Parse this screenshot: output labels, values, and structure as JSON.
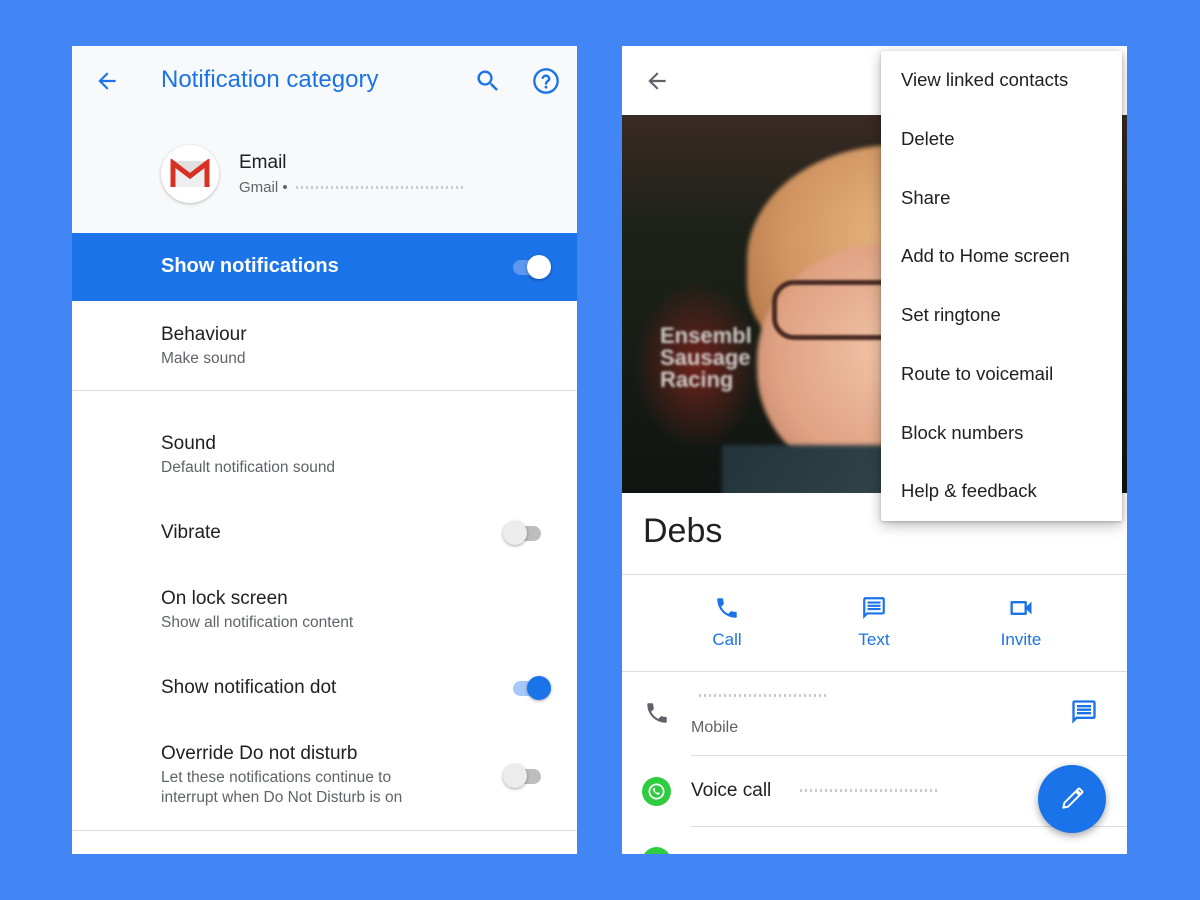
{
  "colors": {
    "background": "#4285f4",
    "accent": "#1a73e8",
    "header_bg": "#f8f9fa",
    "text_primary": "#202124",
    "text_secondary": "#5f6368",
    "whatsapp": "#2ecc40",
    "gmail_red": "#d93025"
  },
  "left_screen": {
    "header": {
      "back_icon": "arrow-left-icon",
      "title": "Notification category",
      "search_icon": "search-icon",
      "help_icon": "help-circle-icon"
    },
    "app": {
      "icon": "gmail-icon",
      "name": "Email",
      "subtitle_prefix": "Gmail •",
      "subtitle_account": "[redacted email address]"
    },
    "show_notifications": {
      "label": "Show notifications",
      "enabled": true
    },
    "settings": [
      {
        "title": "Behaviour",
        "subtitle": "Make sound"
      },
      {
        "title": "Sound",
        "subtitle": "Default notification sound"
      },
      {
        "title": "Vibrate",
        "toggle": false
      },
      {
        "title": "On lock screen",
        "subtitle": "Show all notification content"
      },
      {
        "title": "Show notification dot",
        "toggle": true
      },
      {
        "title": "Override Do not disturb",
        "subtitle": "Let these notifications continue to interrupt when Do Not Disturb is on",
        "toggle": false
      }
    ]
  },
  "right_screen": {
    "header": {
      "back_icon": "arrow-left-icon"
    },
    "photo": {
      "description": "Contact photo of a person with red hair and glasses",
      "background_text": "Ensembl Sausage Racing"
    },
    "contact_name": "Debs",
    "actions": [
      {
        "label": "Call",
        "icon": "phone-icon"
      },
      {
        "label": "Text",
        "icon": "message-icon"
      },
      {
        "label": "Invite",
        "icon": "video-icon"
      }
    ],
    "phone_row": {
      "icon": "phone-icon",
      "number": "[redacted number]",
      "type": "Mobile",
      "message_icon": "message-icon"
    },
    "whatsapp_row": {
      "icon": "whatsapp-icon",
      "label": "Voice call",
      "number": "[redacted number]"
    },
    "fab": {
      "icon": "edit-pencil-icon"
    },
    "overflow_menu": {
      "items": [
        "View linked contacts",
        "Delete",
        "Share",
        "Add to Home screen",
        "Set ringtone",
        "Route to voicemail",
        "Block numbers",
        "Help & feedback"
      ]
    }
  }
}
